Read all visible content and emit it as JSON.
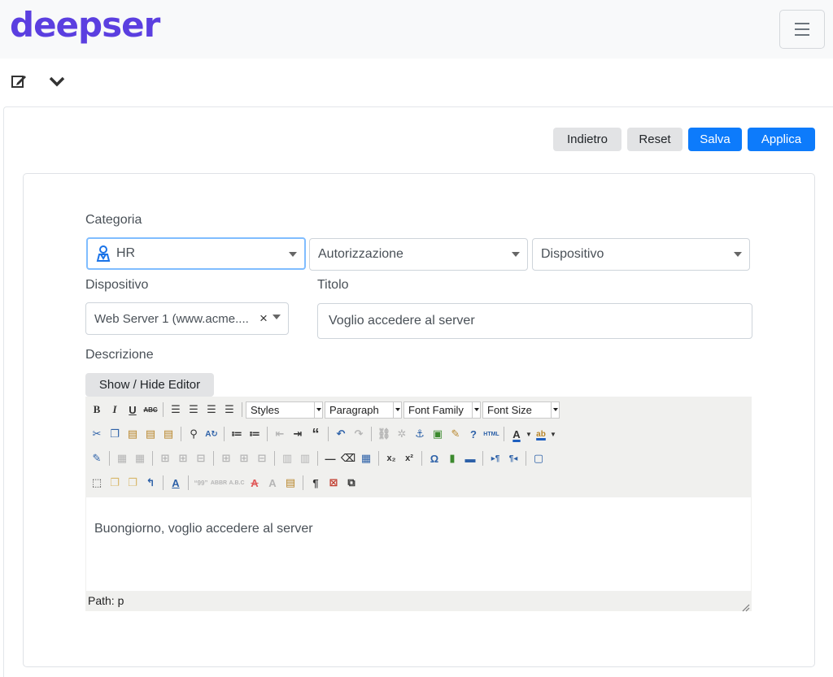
{
  "brand": {
    "logo_text": "deepser",
    "color": "#5b3fe0"
  },
  "subbar": {
    "edit_icon": "edit-icon",
    "chevron_icon": "chevron-down-icon"
  },
  "actions": {
    "back": "Indietro",
    "reset": "Reset",
    "save": "Salva",
    "apply": "Applica"
  },
  "form": {
    "category_label": "Categoria",
    "category_1": {
      "value": "HR",
      "icon": "hr-icon"
    },
    "category_2": {
      "value": "Autorizzazione"
    },
    "category_3": {
      "value": "Dispositivo"
    },
    "device_label": "Dispositivo",
    "device_value": "Web Server 1 (www.acme....",
    "device_clear": "×",
    "title_label": "Titolo",
    "title_value": "Voglio accedere al server",
    "description_label": "Descrizione",
    "toggle_editor": "Show / Hide Editor"
  },
  "editor": {
    "styles": "Styles",
    "format": "Paragraph",
    "font_family": "Font Family",
    "font_size": "Font Size",
    "content": "Buongiorno, voglio accedere al server",
    "path": "Path: p"
  },
  "colors": {
    "primary": "#0d7bfb",
    "secondary": "#e2e3e5",
    "focus": "#80bdff"
  }
}
